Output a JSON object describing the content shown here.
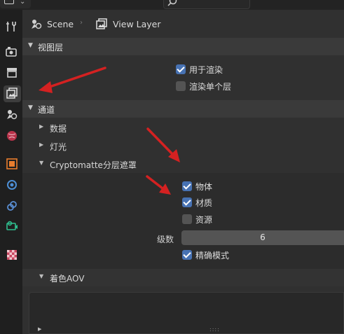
{
  "breadcrumb": {
    "scene": "Scene",
    "view_layer": "View Layer"
  },
  "panels": {
    "view_layer": {
      "title": "视图层",
      "options": [
        {
          "label": "用于渲染",
          "checked": true
        },
        {
          "label": "渲染单个层",
          "checked": false
        }
      ]
    },
    "passes": {
      "title": "通道",
      "subpanels": [
        "数据",
        "灯光",
        "Cryptomatte分层遮罩"
      ],
      "cryptomatte_options": [
        {
          "label": "物体",
          "checked": true
        },
        {
          "label": "材质",
          "checked": true
        },
        {
          "label": "资源",
          "checked": false
        }
      ],
      "levels": {
        "label": "级数",
        "value": "6"
      },
      "accurate": {
        "label": "精确模式",
        "checked": true
      }
    },
    "shader_aov": {
      "title": "着色AOV"
    }
  },
  "icons": {
    "tabs": [
      "tool-icon",
      "render-icon",
      "output-icon",
      "view-layer-icon",
      "scene-icon",
      "world-icon",
      "object-icon",
      "physics-icon",
      "constraints-icon",
      "data-icon",
      "texture-icon"
    ]
  },
  "colors": {
    "accent": "#4772b3",
    "annotation_arrow": "#d42121"
  }
}
